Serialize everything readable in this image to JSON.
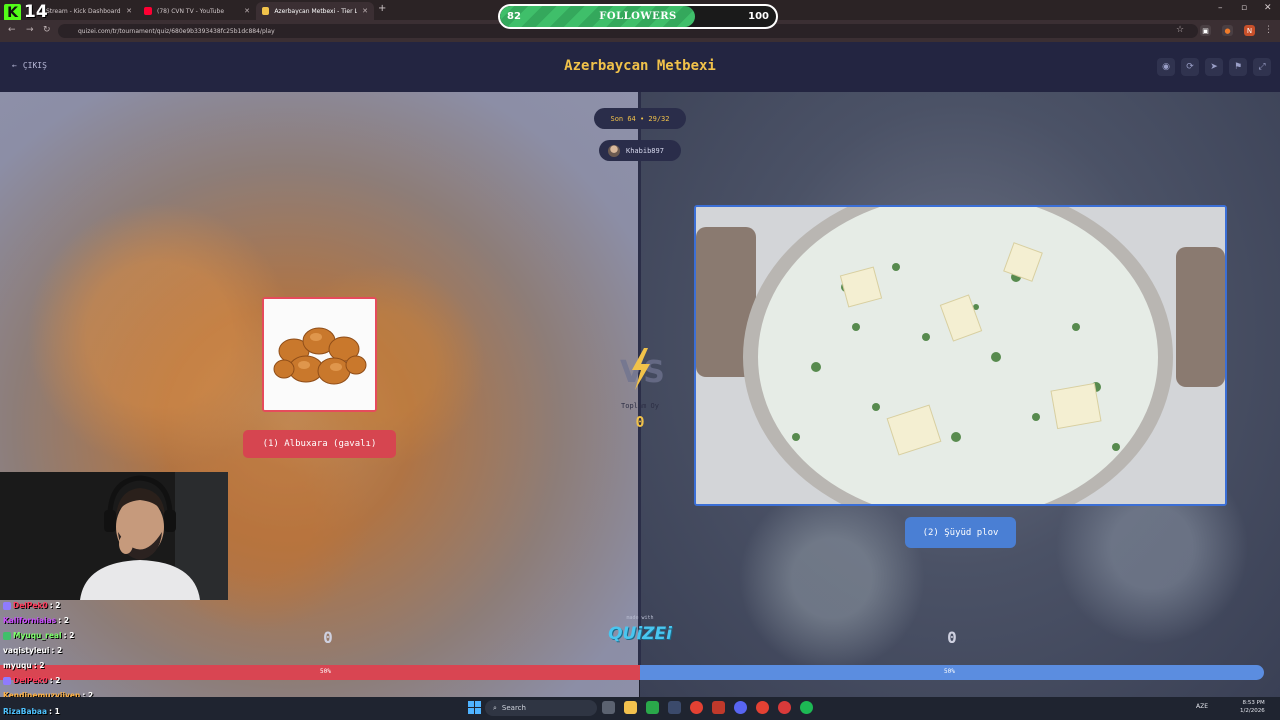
{
  "browser": {
    "tabs": [
      {
        "label": "Stream - Kick Dashboard",
        "color": "#53fc18"
      },
      {
        "label": "(78) CVN TV - YouTube",
        "color": "#ff0033"
      },
      {
        "label": "Azerbaycan Metbexi - Tier List",
        "color": "#f1c24a"
      }
    ],
    "new_tab": "+",
    "url": "quizei.com/tr/tournament/quiz/680e9b3393438fc25b1dc884/play"
  },
  "overlay": {
    "kick_logo": "K",
    "kick_count": "14",
    "followers": {
      "label": "FOLLOWERS",
      "current": "82",
      "goal": "100",
      "progress": 0.82
    }
  },
  "app": {
    "exit_label": "ÇIKIŞ",
    "title": "Azerbaycan Metbexi",
    "round": "Son 64 • 29/32",
    "username": "Khabib897",
    "total_label": "Toplam Oy",
    "total_value": "0",
    "left": {
      "label": "(1) Albuxara (gavalı)",
      "votes": "0",
      "percent": "50%",
      "color": "#d94552"
    },
    "right": {
      "label": "(2) Şüyüd plov",
      "votes": "0",
      "percent": "50%",
      "color": "#5b8de0"
    },
    "made_with": "made with",
    "brand": "QUiZEi",
    "vs_label": "VS"
  },
  "chat": [
    {
      "name": "DelPek0",
      "msg": ": 2",
      "color": "#ff3b5c",
      "badge": true
    },
    {
      "name": "Kaliforniaias",
      "msg": ": 2",
      "color": "#c94cff",
      "badge": false
    },
    {
      "name": "Myuqu_real",
      "msg": ": 2",
      "color": "#7dff6b",
      "badge": true
    },
    {
      "name": "vaqistyleui",
      "msg": ": 2",
      "color": "#ffffff",
      "badge": false
    },
    {
      "name": "myuqu",
      "msg": ": 2",
      "color": "#ffffff",
      "badge": false
    },
    {
      "name": "DelPek0",
      "msg": ": 2",
      "color": "#ff3b5c",
      "badge": true
    },
    {
      "name": "Kendinemuzyiiyen",
      "msg": ": 2",
      "color": "#ffb347",
      "badge": false
    },
    {
      "name": "RizaBabaa",
      "msg": ": 1",
      "color": "#4fc3ff",
      "badge": false
    }
  ],
  "taskbar": {
    "search": "Search",
    "lang": "AZE",
    "time": "8:53 PM",
    "date": "1/2/2026"
  },
  "icons": [
    "back-arrow-icon",
    "forward-arrow-icon",
    "reload-icon",
    "star-icon",
    "eye-icon",
    "share-icon",
    "send-icon",
    "flag-icon",
    "fullscreen-icon",
    "windows-start-icon",
    "search-icon"
  ]
}
